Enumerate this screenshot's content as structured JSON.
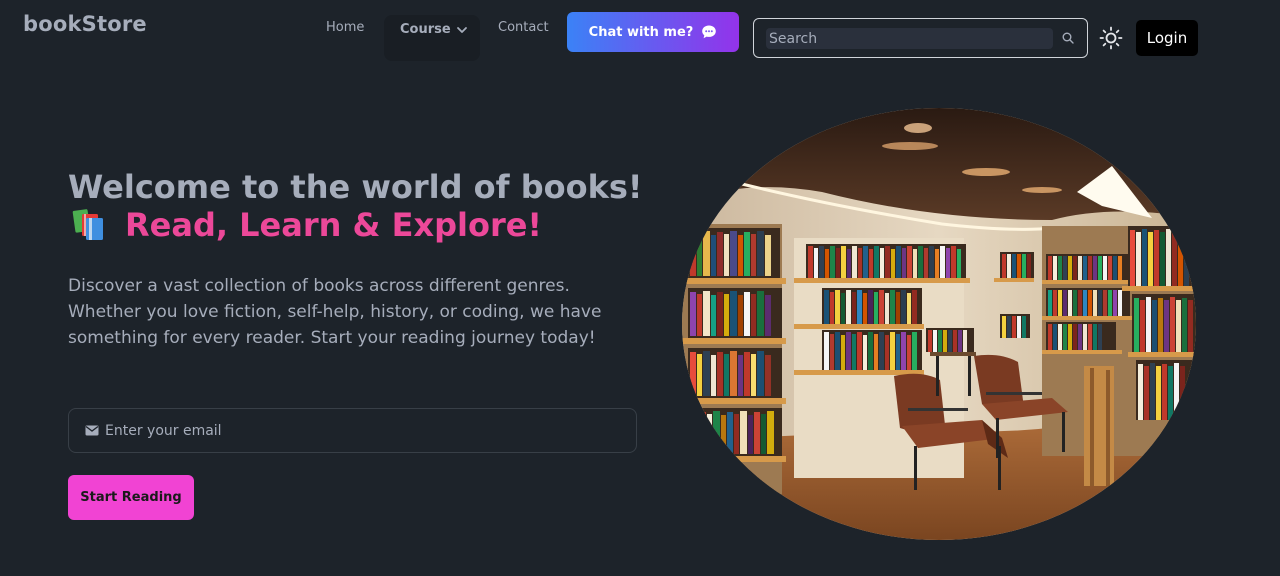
{
  "brand": "bookStore",
  "nav": {
    "home": "Home",
    "course": "Course",
    "contact": "Contact"
  },
  "chat_button": {
    "label": "Chat with me?",
    "icon": "chat-bubble-icon"
  },
  "search": {
    "placeholder": "Search",
    "value": ""
  },
  "login_label": "Login",
  "hero": {
    "title": "Welcome to the world of books!",
    "subtitle": "Read, Learn & Explore!",
    "subtitle_icon": "books-icon",
    "description": "Discover a vast collection of books across different genres. Whether you love fiction, self-help, history, or coding, we have something for every reader. Start your reading journey today!",
    "email_placeholder": "Enter your email",
    "cta_label": "Start Reading"
  },
  "colors": {
    "background": "#1d232a",
    "text": "#a6adbb",
    "accent_pink": "#ec4899",
    "cta_pink": "#f143d3",
    "chat_gradient_start": "#3b82f6",
    "chat_gradient_end": "#9333ea"
  }
}
